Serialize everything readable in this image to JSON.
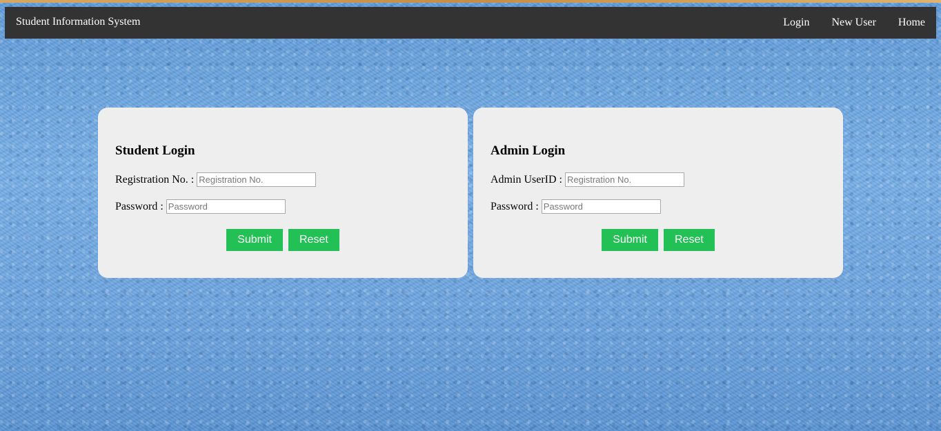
{
  "navbar": {
    "brand": "Student Information System",
    "links": [
      "Login",
      "New User",
      "Home"
    ]
  },
  "student_login": {
    "title": "Student Login",
    "reg_label": "Registration No. :",
    "reg_placeholder": "Registration No.",
    "password_label": "Password :",
    "password_placeholder": "Password",
    "submit_label": "Submit",
    "reset_label": "Reset"
  },
  "admin_login": {
    "title": "Admin Login",
    "userid_label": "Admin UserID :",
    "userid_placeholder": "Registration No.",
    "password_label": "Password :",
    "password_placeholder": "Password",
    "submit_label": "Submit",
    "reset_label": "Reset"
  },
  "colors": {
    "navbar_bg": "#333333",
    "card_bg": "#eeeeee",
    "button_bg": "#22c055",
    "page_bg": "#6fa5da"
  }
}
